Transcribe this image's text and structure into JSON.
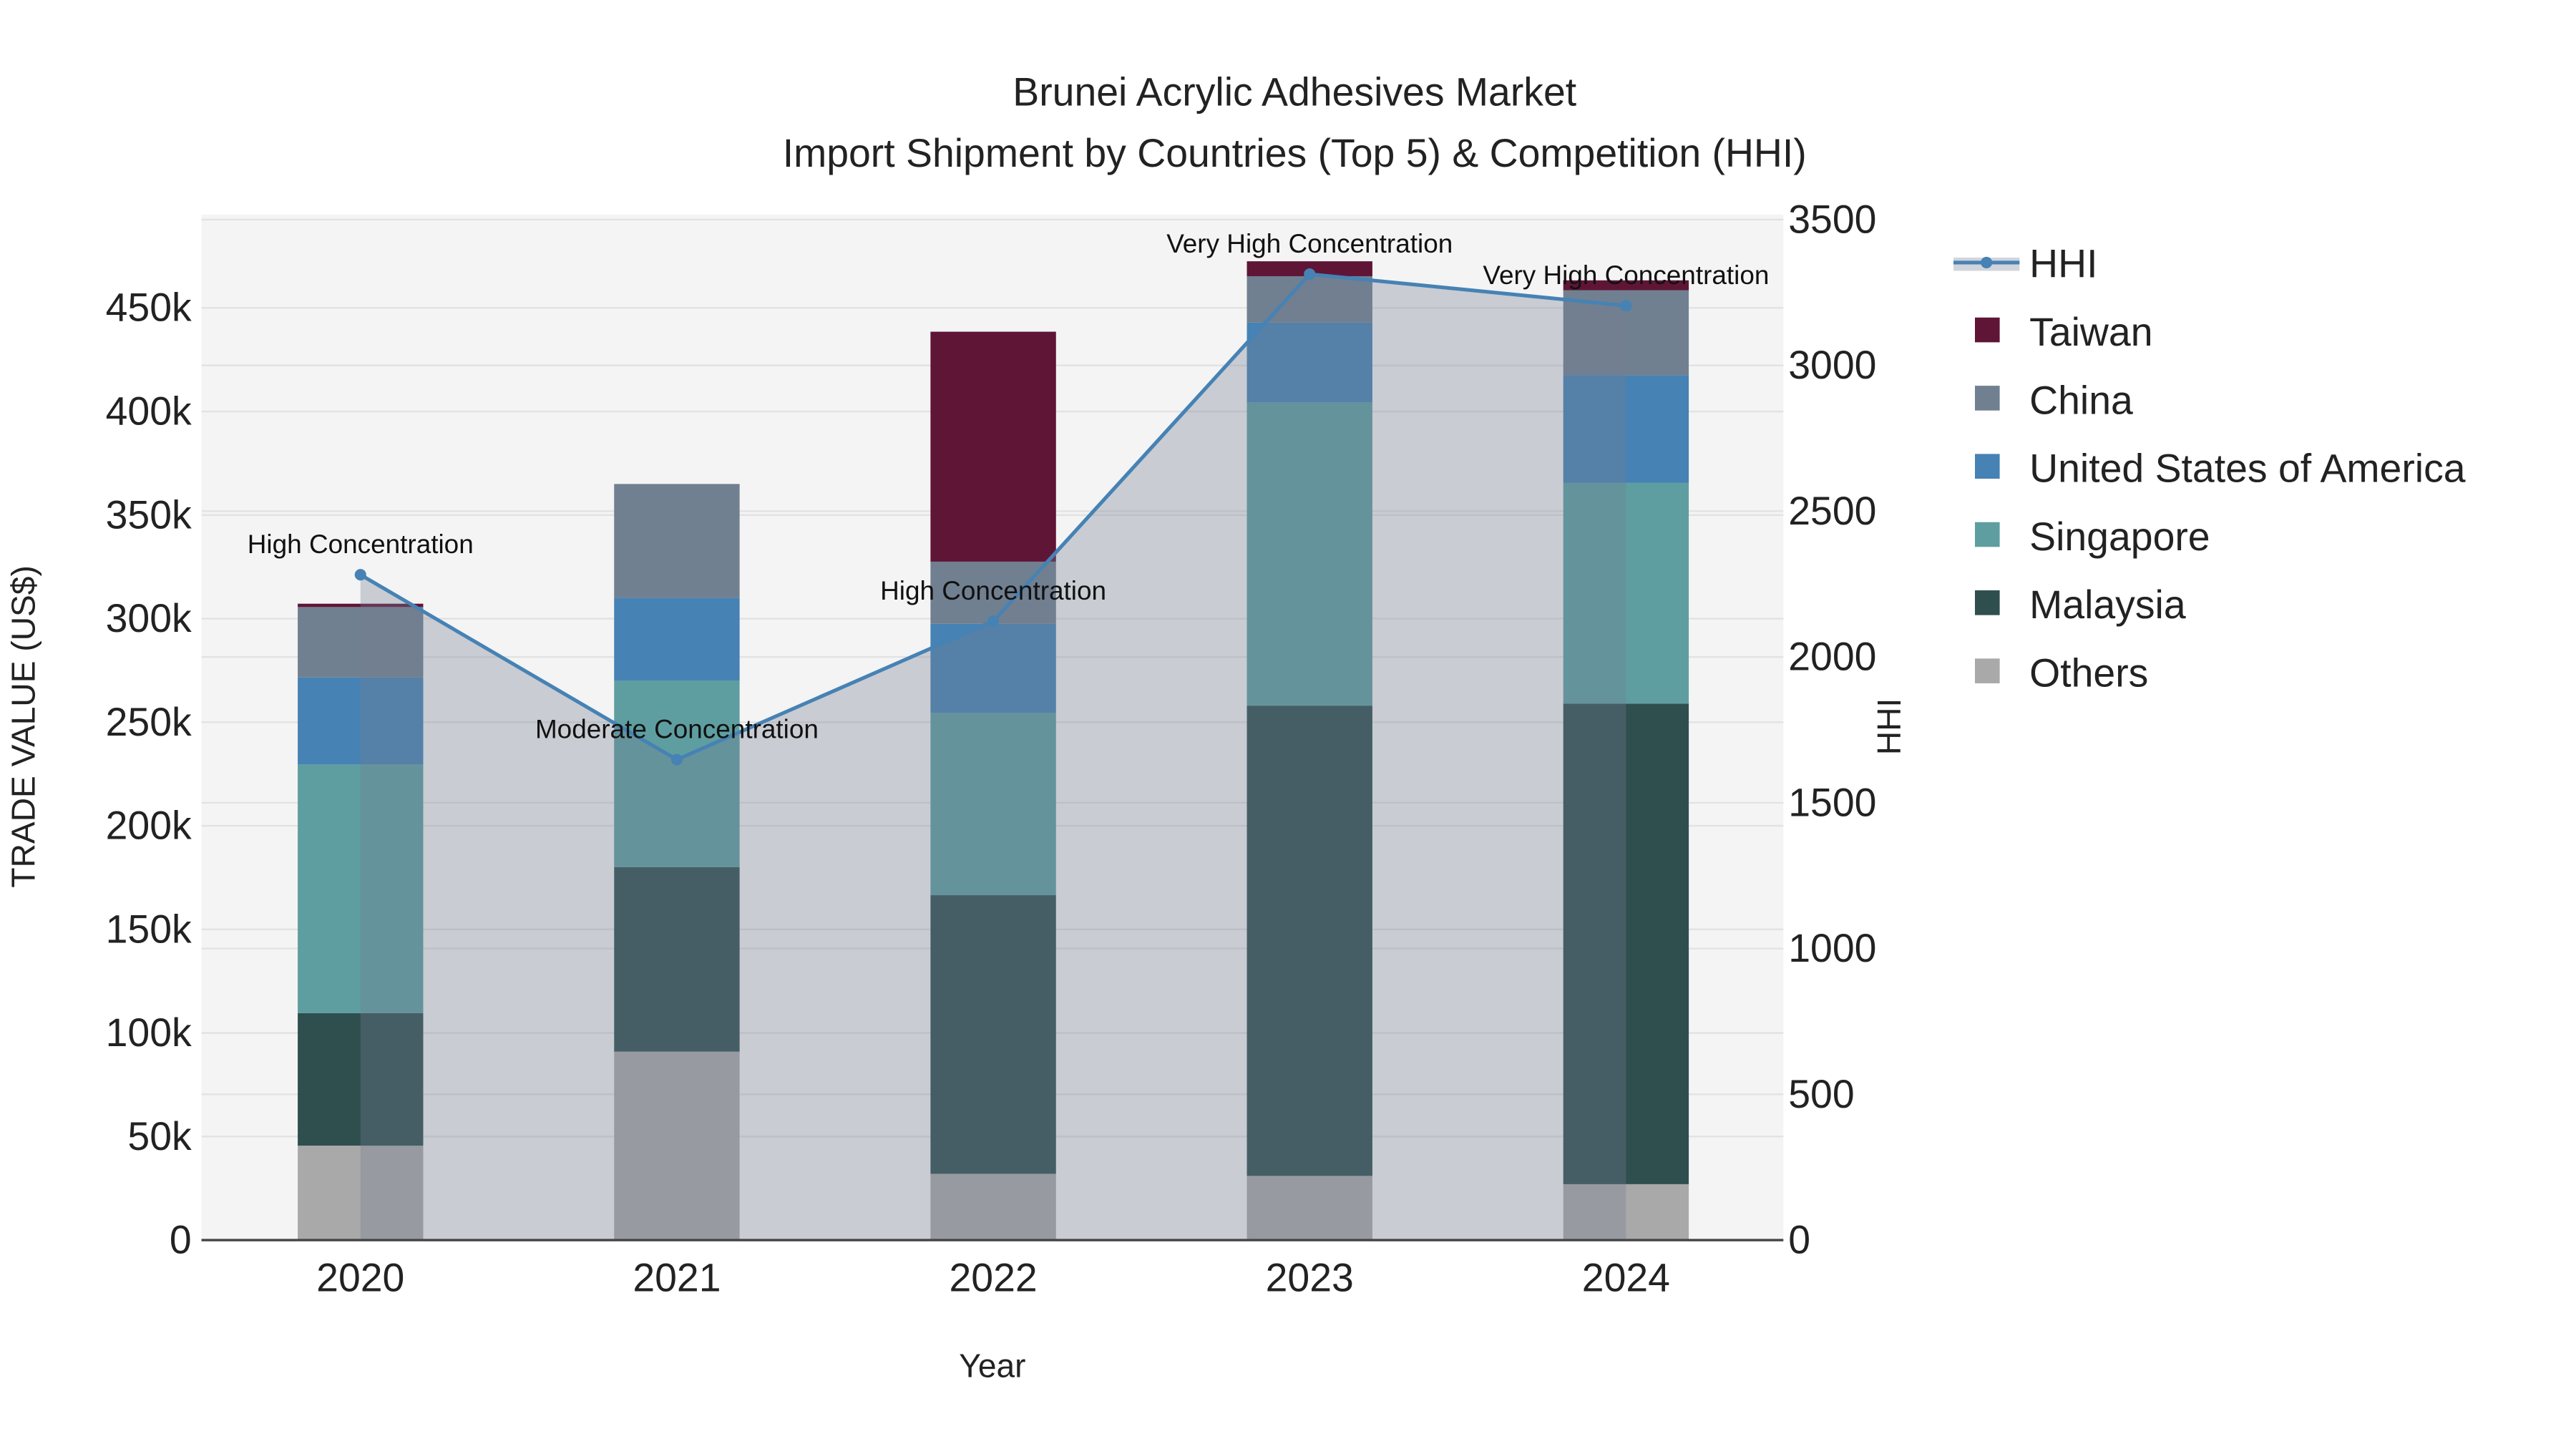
{
  "chart_data": {
    "type": "bar",
    "title": "Brunei Acrylic Adhesives Market",
    "subtitle": "Import Shipment by Countries (Top 5) & Competition (HHI)",
    "xlabel": "Year",
    "ylabel": "TRADE VALUE (US$)",
    "y2label": "HHI",
    "categories": [
      "2020",
      "2021",
      "2022",
      "2023",
      "2024"
    ],
    "ylim": [
      0,
      495000
    ],
    "y_ticks": [
      0,
      50000,
      100000,
      150000,
      200000,
      250000,
      300000,
      350000,
      400000,
      450000
    ],
    "y_tick_labels": [
      "0",
      "50k",
      "100k",
      "150k",
      "200k",
      "250k",
      "300k",
      "350k",
      "400k",
      "450k"
    ],
    "y2lim": [
      0,
      3500
    ],
    "y2_ticks": [
      0,
      500,
      1000,
      1500,
      2000,
      2500,
      3000,
      3500
    ],
    "y2_tick_labels": [
      "0",
      "500",
      "1000",
      "1500",
      "2000",
      "2500",
      "3000",
      "3500"
    ],
    "stacked": true,
    "series": [
      {
        "name": "Others",
        "color": "#a9a9a9",
        "values": [
          45600,
          91000,
          32000,
          31000,
          27000
        ]
      },
      {
        "name": "Malaysia",
        "color": "#2f4f4f",
        "values": [
          64000,
          89000,
          134500,
          227000,
          232000
        ]
      },
      {
        "name": "Singapore",
        "color": "#5f9ea0",
        "values": [
          120000,
          90000,
          88000,
          146500,
          106500
        ]
      },
      {
        "name": "United States of America",
        "color": "#4682b4",
        "values": [
          42000,
          40000,
          43000,
          38400,
          52000
        ]
      },
      {
        "name": "China",
        "color": "#708090",
        "values": [
          34000,
          55000,
          30000,
          22400,
          41000
        ]
      },
      {
        "name": "Taiwan",
        "color": "#5f1536",
        "values": [
          1600,
          0,
          111000,
          7200,
          4800
        ]
      }
    ],
    "line": {
      "name": "HHI",
      "color": "#4682b4",
      "axis": "right",
      "values": [
        2282,
        1648,
        2123,
        3313,
        3205
      ]
    },
    "annotations": [
      "High Concentration",
      "Moderate Concentration",
      "High Concentration",
      "Very High Concentration",
      "Very High Concentration"
    ],
    "legend_order": [
      "HHI",
      "Taiwan",
      "China",
      "United States of America",
      "Singapore",
      "Malaysia",
      "Others"
    ],
    "legend_position": "right",
    "grid": true
  }
}
